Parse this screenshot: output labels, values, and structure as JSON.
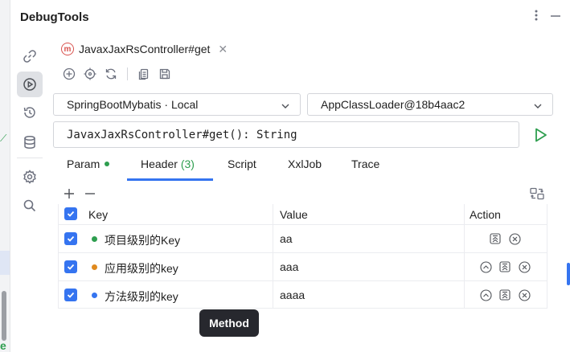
{
  "window": {
    "title": "DebugTools"
  },
  "tab": {
    "icon_letter": "m",
    "label": "JavaxJaxRsController#get"
  },
  "selectors": {
    "app": "SpringBootMybatis · Local",
    "classloader": "AppClassLoader@18b4aac2"
  },
  "method_signature": "JavaxJaxRsController#get(): String",
  "subtabs": {
    "param": "Param",
    "header": "Header",
    "header_count": "(3)",
    "script": "Script",
    "xxljob": "XxlJob",
    "trace": "Trace"
  },
  "table": {
    "columns": {
      "key": "Key",
      "value": "Value",
      "action": "Action"
    },
    "rows": [
      {
        "key": "项目级别的Key",
        "value": "aa",
        "dot_color": "#2e9e4f"
      },
      {
        "key": "应用级别的key",
        "value": "aaa",
        "dot_color": "#e08a1e"
      },
      {
        "key": "方法级别的key",
        "value": "aaaa",
        "dot_color": "#3574f0"
      }
    ]
  },
  "tooltip": "Method",
  "colors": {
    "accent": "#3574f0",
    "run_green": "#2e9e4f",
    "tab_icon_red": "#d9534f"
  }
}
